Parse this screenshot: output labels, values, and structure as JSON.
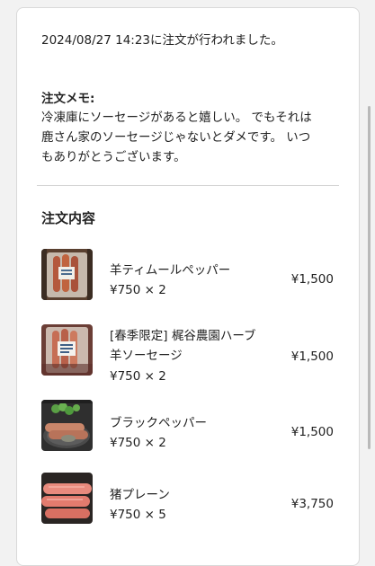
{
  "order": {
    "timestamp_line": "2024/08/27 14:23に注文が行われました。",
    "memo_heading": "注文メモ:",
    "memo_lines": [
      "冷凍庫にソーセージがあると嬉しい。 でもそれは",
      "鹿さん家のソーセージじゃないとダメです。 いつ",
      "もありがとうございます。"
    ],
    "section_title": "注文内容",
    "items": [
      {
        "name": "羊ティムールペッパー",
        "qty": "¥750 × 2",
        "price": "¥1,500",
        "image": "sausage-pack-image"
      },
      {
        "name_lines": [
          "[春季限定] 梶谷農園ハーブ",
          "羊ソーセージ"
        ],
        "qty": "¥750 × 2",
        "price": "¥1,500",
        "image": "sausage-pack-image"
      },
      {
        "name": "ブラックペッパー",
        "qty": "¥750 × 2",
        "price": "¥1,500",
        "image": "grilled-sausage-plate-image"
      },
      {
        "name": "猪プレーン",
        "qty": "¥750 × 5",
        "price": "¥3,750",
        "image": "raw-sausage-image"
      }
    ]
  }
}
